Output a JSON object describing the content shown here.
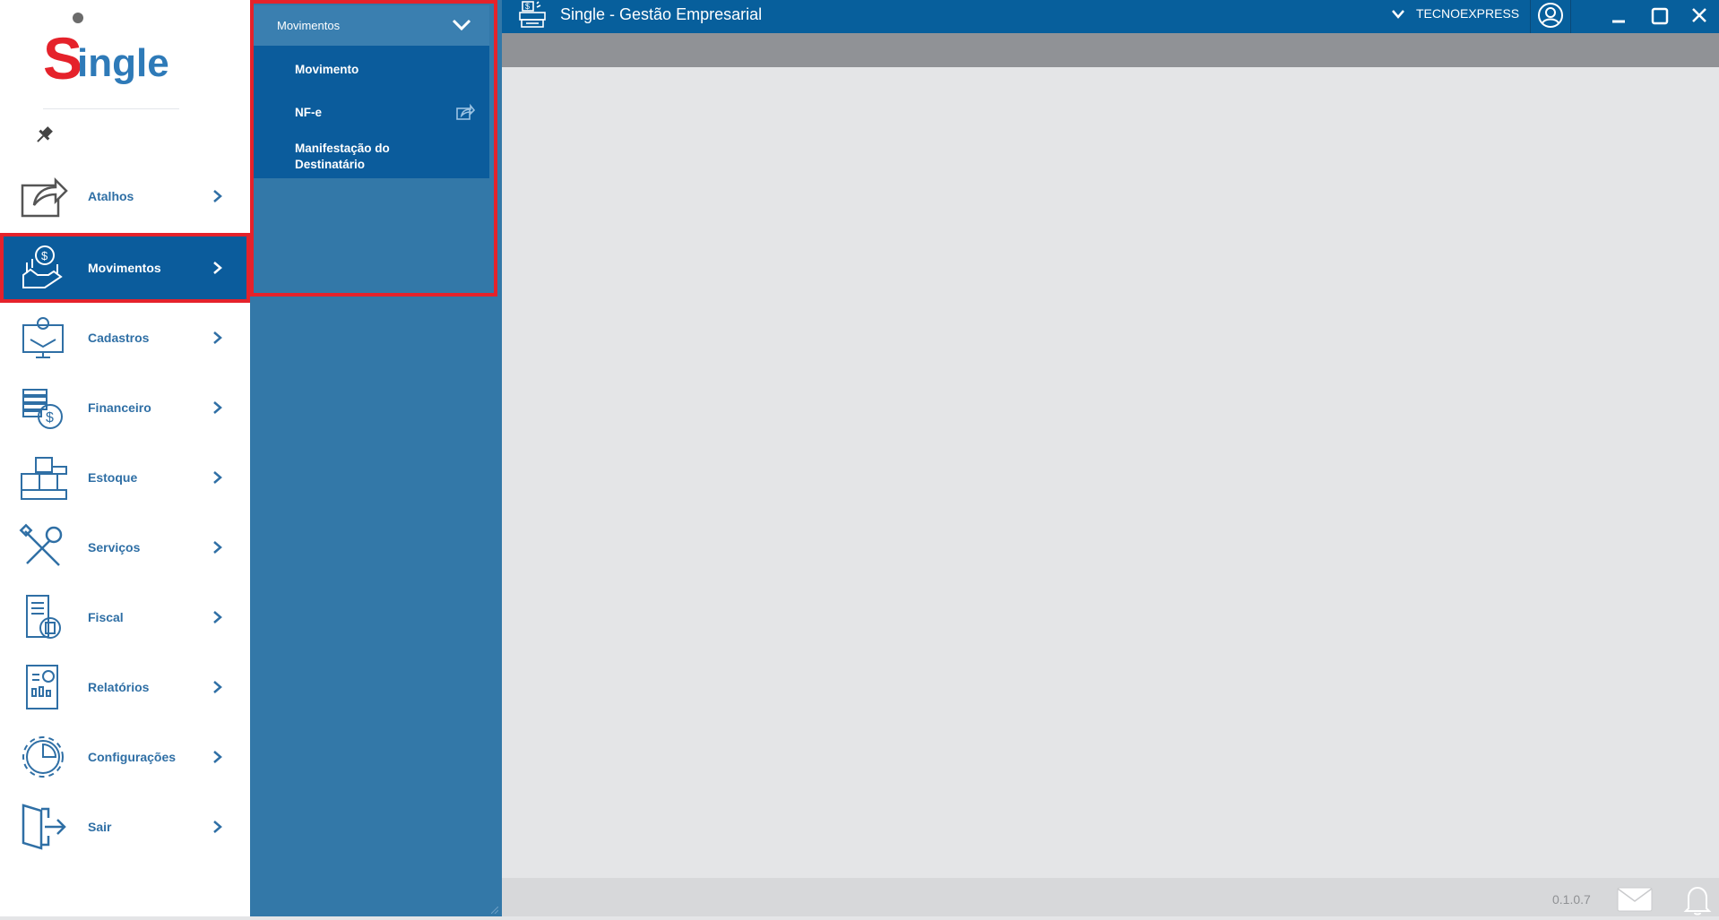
{
  "app": {
    "title": "Single - Gestão Empresarial",
    "logo_text": "Single",
    "company": "TECNOEXPRESS",
    "version": "0.1.0.7"
  },
  "sidebar": {
    "items": [
      {
        "label": "Atalhos",
        "icon": "share-icon"
      },
      {
        "label": "Movimentos",
        "icon": "money-hand-icon",
        "active": true
      },
      {
        "label": "Cadastros",
        "icon": "monitor-user-icon"
      },
      {
        "label": "Financeiro",
        "icon": "coins-icon"
      },
      {
        "label": "Estoque",
        "icon": "boxes-icon"
      },
      {
        "label": "Serviços",
        "icon": "tools-icon"
      },
      {
        "label": "Fiscal",
        "icon": "receipt-icon"
      },
      {
        "label": "Relatórios",
        "icon": "report-icon"
      },
      {
        "label": "Configurações",
        "icon": "gear-chart-icon"
      },
      {
        "label": "Sair",
        "icon": "exit-door-icon"
      }
    ]
  },
  "submenu": {
    "header": "Movimentos",
    "items": [
      {
        "label": "Movimento"
      },
      {
        "label": "NF-e",
        "icon": "external-link-icon"
      },
      {
        "label": "Manifestação do\nDestinatário"
      }
    ]
  },
  "colors": {
    "accent": "#0b5c9c",
    "topbar": "#075f9c",
    "panel": "#3378a8",
    "highlight_border": "#e5222b",
    "label": "#2f6fa5"
  }
}
